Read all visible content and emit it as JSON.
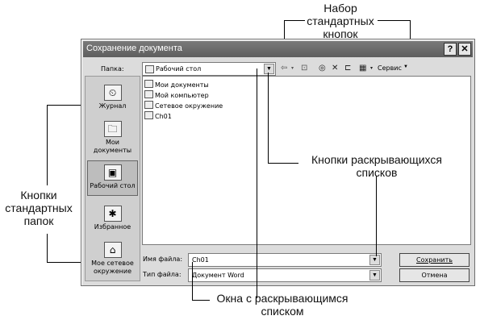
{
  "annotations": {
    "top_label": [
      "Набор",
      "стандартных",
      "кнопок"
    ],
    "left_label": [
      "Кнопки",
      "стандартных",
      "папок"
    ],
    "right_label": [
      "Кнопки раскрывающихся",
      "списков"
    ],
    "bottom_label": [
      "Окна с раскрывающимся",
      "списком"
    ]
  },
  "dialog": {
    "title": "Сохранение документа",
    "help_glyph": "?",
    "close_glyph": "✕",
    "folder_label": "Папка:",
    "folder_value": "Рабочий стол",
    "tools_label": "Сервис",
    "dropdown_glyph": "▼",
    "places": [
      {
        "label": "Журнал",
        "icon": "history-icon",
        "glyph": "⏲"
      },
      {
        "label": "Мои документы",
        "icon": "my-documents-icon",
        "glyph": "🗀"
      },
      {
        "label": "Рабочий стол",
        "icon": "desktop-icon",
        "glyph": "▣"
      },
      {
        "label": "Избранное",
        "icon": "favorites-icon",
        "glyph": "✱"
      },
      {
        "label": "Мое сетевое окружение",
        "icon": "network-icon",
        "glyph": "⌂"
      }
    ],
    "files": [
      "Мои документы",
      "Мой компьютер",
      "Сетевое окружение",
      "Ch01"
    ],
    "filename_label": "Имя файла:",
    "filename_value": "Ch01",
    "filetype_label": "Тип файла:",
    "filetype_value": "Документ Word",
    "save_label": "Сохранить",
    "cancel_label": "Отмена"
  }
}
